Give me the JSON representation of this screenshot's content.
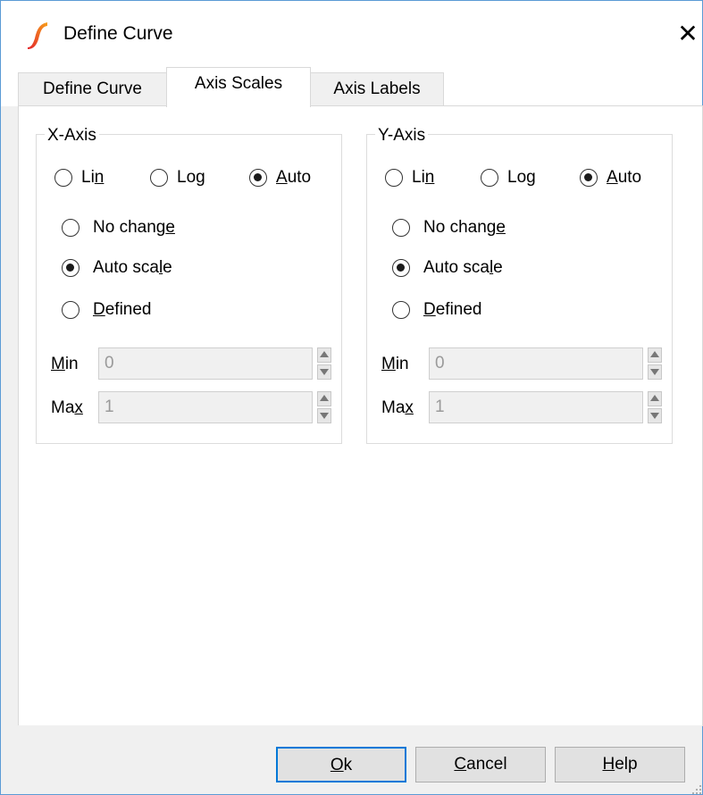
{
  "window": {
    "title": "Define Curve",
    "close_glyph": "✕",
    "accent": "#0078d7"
  },
  "tabs": [
    {
      "label": "Define Curve",
      "active": false
    },
    {
      "label": "Axis Scales",
      "active": true
    },
    {
      "label": "Axis Labels",
      "active": false
    }
  ],
  "x_axis": {
    "title": "X-Axis",
    "scale_options": [
      {
        "pre": "Li",
        "u": "n",
        "post": "",
        "checked": false
      },
      {
        "pre": "Lo",
        "u": "g",
        "post": "",
        "checked": false
      },
      {
        "pre": "",
        "u": "A",
        "post": "uto",
        "checked": true
      }
    ],
    "range_options": [
      {
        "pre": "No chang",
        "u": "e",
        "post": "",
        "checked": false
      },
      {
        "pre": "Auto sca",
        "u": "l",
        "post": "e",
        "checked": true
      },
      {
        "pre": "",
        "u": "D",
        "post": "efined",
        "checked": false
      }
    ],
    "min": {
      "pre": "",
      "u": "M",
      "post": "in",
      "value": "0"
    },
    "max": {
      "pre": "Ma",
      "u": "x",
      "post": "",
      "value": "1"
    }
  },
  "y_axis": {
    "title": "Y-Axis",
    "scale_options": [
      {
        "pre": "Li",
        "u": "n",
        "post": "",
        "checked": false
      },
      {
        "pre": "Lo",
        "u": "g",
        "post": "",
        "checked": false
      },
      {
        "pre": "",
        "u": "A",
        "post": "uto",
        "checked": true
      }
    ],
    "range_options": [
      {
        "pre": "No chang",
        "u": "e",
        "post": "",
        "checked": false
      },
      {
        "pre": "Auto sca",
        "u": "l",
        "post": "e",
        "checked": true
      },
      {
        "pre": "",
        "u": "D",
        "post": "efined",
        "checked": false
      }
    ],
    "min": {
      "pre": "",
      "u": "M",
      "post": "in",
      "value": "0"
    },
    "max": {
      "pre": "Ma",
      "u": "x",
      "post": "",
      "value": "1"
    }
  },
  "buttons": {
    "ok": {
      "pre": "",
      "u": "O",
      "post": "k"
    },
    "cancel": {
      "pre": "",
      "u": "C",
      "post": "ancel"
    },
    "help": {
      "pre": "",
      "u": "H",
      "post": "elp"
    }
  },
  "icons": {
    "app": "simetrix-curve-icon",
    "close": "close-icon",
    "spin": "spin-arrows-icon"
  }
}
